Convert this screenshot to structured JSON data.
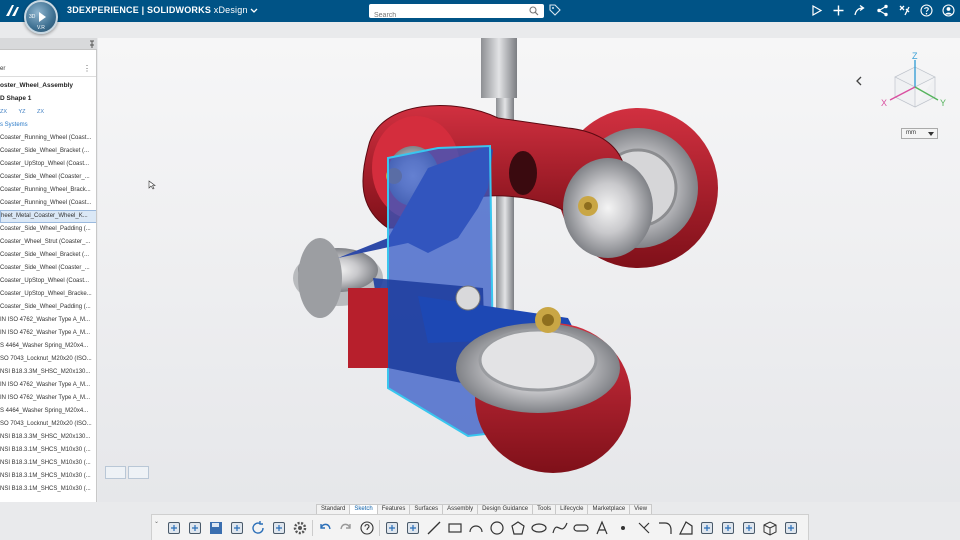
{
  "app": {
    "brand_prefix": "3DEXPERIENCE | SOLIDWORKS",
    "brand_app": "xDesign",
    "compass_left": "3D",
    "compass_bottom": "V.R"
  },
  "search": {
    "placeholder": "Search"
  },
  "left_panel": {
    "filter_label": "er",
    "more_label": "⋮",
    "assembly_title": "oster_Wheel_Assembly",
    "shape_label": "D Shape 1",
    "mini_icons": [
      "ZX",
      "YZ",
      "ZX"
    ],
    "systems_label": "s Systems",
    "items": [
      "Coaster_Running_Wheel (Coast...",
      "Coaster_Side_Wheel_Bracket (...",
      "Coaster_UpStop_Wheel (Coast...",
      "Coaster_Side_Wheel (Coaster_...",
      "Coaster_Running_Wheel_Brack...",
      "Coaster_Running_Wheel (Coast...",
      "heet_Metal_Coaster_Wheel_K...",
      "Coaster_Side_Wheel_Padding (...",
      "Coaster_Wheel_Strut (Coaster_...",
      "Coaster_Side_Wheel_Bracket (...",
      "Coaster_Side_Wheel (Coaster_...",
      "Coaster_UpStop_Wheel (Coast...",
      "Coaster_UpStop_Wheel_Bracke...",
      "Coaster_Side_Wheel_Padding (...",
      "IN ISO 4762_Washer Type A_M...",
      "IN ISO 4762_Washer Type A_M...",
      "S 4464_Washer Spring_M20x4...",
      "SO 7043_Locknut_M20x20 (ISO...",
      "NSI B18.3.3M_SHSC_M20x130...",
      "IN ISO 4762_Washer Type A_M...",
      "IN ISO 4762_Washer Type A_M...",
      "S 4464_Washer Spring_M20x4...",
      "SO 7043_Locknut_M20x20 (ISO...",
      "NSI B18.3.3M_SHSC_M20x130...",
      "NSI B18.3.1M_SHCS_M10x30 (...",
      "NSI B18.3.1M_SHCS_M10x30 (...",
      "NSI B18.3.1M_SHCS_M10x30 (...",
      "NSI B18.3.1M_SHCS_M10x30 (..."
    ],
    "selected_index": 6
  },
  "viewport": {
    "unit": "mm",
    "triad_labels": {
      "x": "X",
      "y": "Y",
      "z": "Z"
    },
    "colors": {
      "accent": "#005386",
      "wheel_red": "#b31f2c",
      "sheet_blue": "#1f4fb8"
    }
  },
  "action_bar": {
    "tabs": [
      "Standard",
      "Sketch",
      "Features",
      "Surfaces",
      "Assembly",
      "Design Guidance",
      "Tools",
      "Lifecycle",
      "Marketplace",
      "View"
    ],
    "active_tab": "Sketch",
    "tools": [
      "insert-part-icon",
      "new-component-icon",
      "save-icon",
      "save-with-options-icon",
      "refresh-icon",
      "cut-icon",
      "options-gear-icon",
      "undo-icon",
      "redo-icon",
      "help-icon",
      "sheet-icon",
      "sketch-pen-icon",
      "line-icon",
      "rectangle-icon",
      "arc-icon",
      "circle-icon",
      "polygon-icon",
      "ellipse-icon",
      "spline-icon",
      "slot-icon",
      "text-icon",
      "point-icon",
      "trim-icon",
      "fillet-icon",
      "chamfer-icon",
      "mirror-icon",
      "offset-icon",
      "constraint-icon",
      "box-icon",
      "sketch-exit-icon"
    ]
  }
}
